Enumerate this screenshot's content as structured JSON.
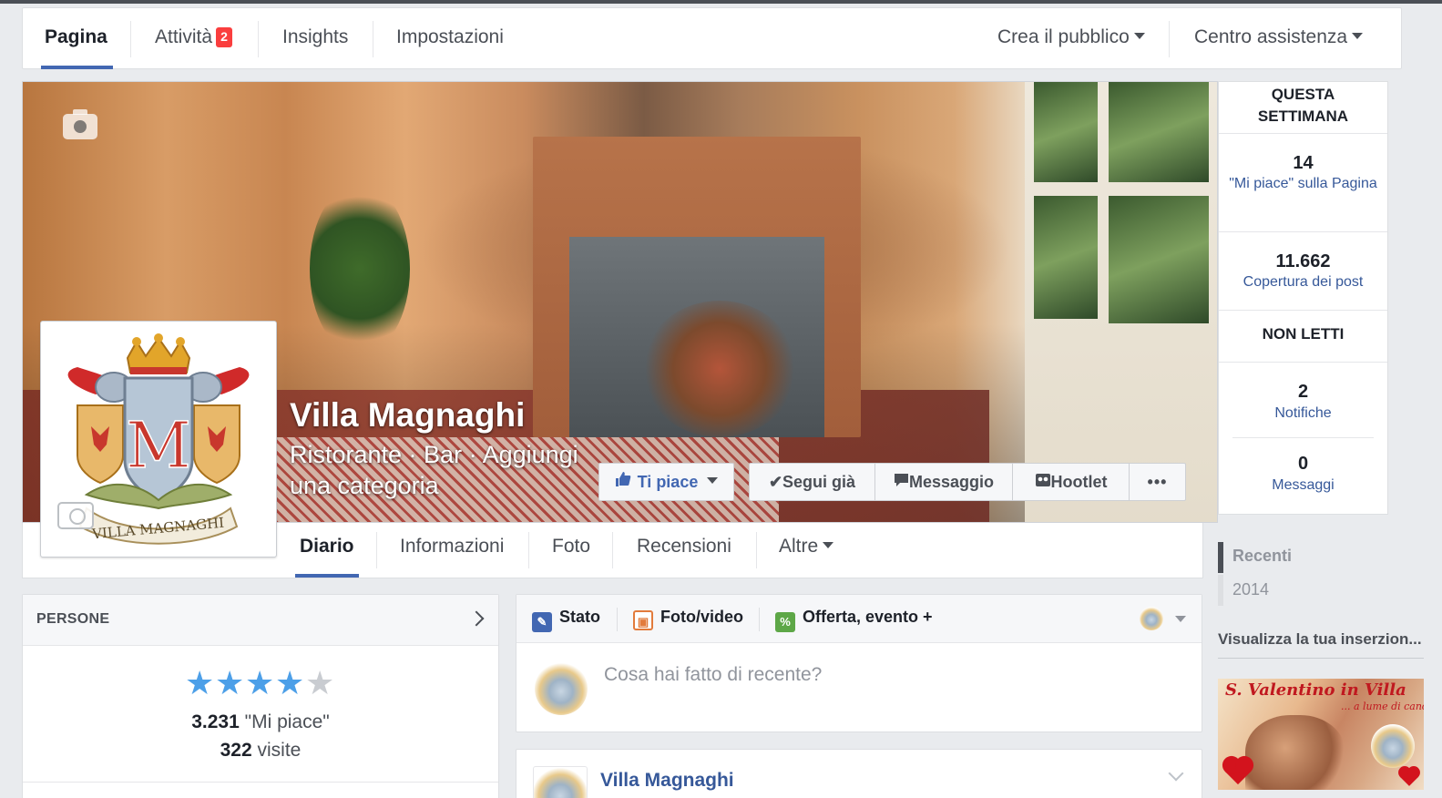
{
  "admin_nav": {
    "tabs": [
      {
        "label": "Pagina"
      },
      {
        "label": "Attività",
        "badge": "2"
      },
      {
        "label": "Insights"
      },
      {
        "label": "Impostazioni"
      }
    ],
    "right": [
      {
        "label": "Crea il pubblico"
      },
      {
        "label": "Centro assistenza"
      }
    ]
  },
  "page": {
    "name": "Villa Magnaghi",
    "category": "Ristorante · Bar · Aggiungi una categoria",
    "logo_text": "VILLA MAGNAGHI"
  },
  "cover_actions": {
    "like": "Ti piace",
    "follow": "Segui già",
    "message": "Messaggio",
    "hootlet": "Hootlet",
    "more": "•••"
  },
  "page_tabs": [
    "Diario",
    "Informazioni",
    "Foto",
    "Recensioni",
    "Altre"
  ],
  "stats": {
    "week_title": "QUESTA SETTIMANA",
    "likes_num": "14",
    "likes_label": "\"Mi piace\" sulla Pagina",
    "reach_num": "11.662",
    "reach_label": "Copertura dei post",
    "unread_title": "NON LETTI",
    "notif_num": "2",
    "notif_label": "Notifiche",
    "msg_num": "0",
    "msg_label": "Messaggi"
  },
  "timeline": [
    "Recenti",
    "2014"
  ],
  "ads": {
    "title": "Visualizza la tua inserzion...",
    "line1": "S. Valentino in Villa",
    "line2": "... a lume di candela"
  },
  "people": {
    "title": "PERSONE",
    "rating": 4,
    "likes_count": "3.231",
    "likes_label": "\"Mi piace\"",
    "visits_count": "322",
    "visits_label": "visite"
  },
  "composer": {
    "tabs": [
      "Stato",
      "Foto/video",
      "Offerta, evento +"
    ],
    "placeholder": "Cosa hai fatto di recente?"
  },
  "post": {
    "name": "Villa Magnaghi"
  },
  "colors": {
    "accent": "#4267b2",
    "link": "#365899",
    "badge": "#fa3e3e",
    "star": "#4c9fe8"
  }
}
